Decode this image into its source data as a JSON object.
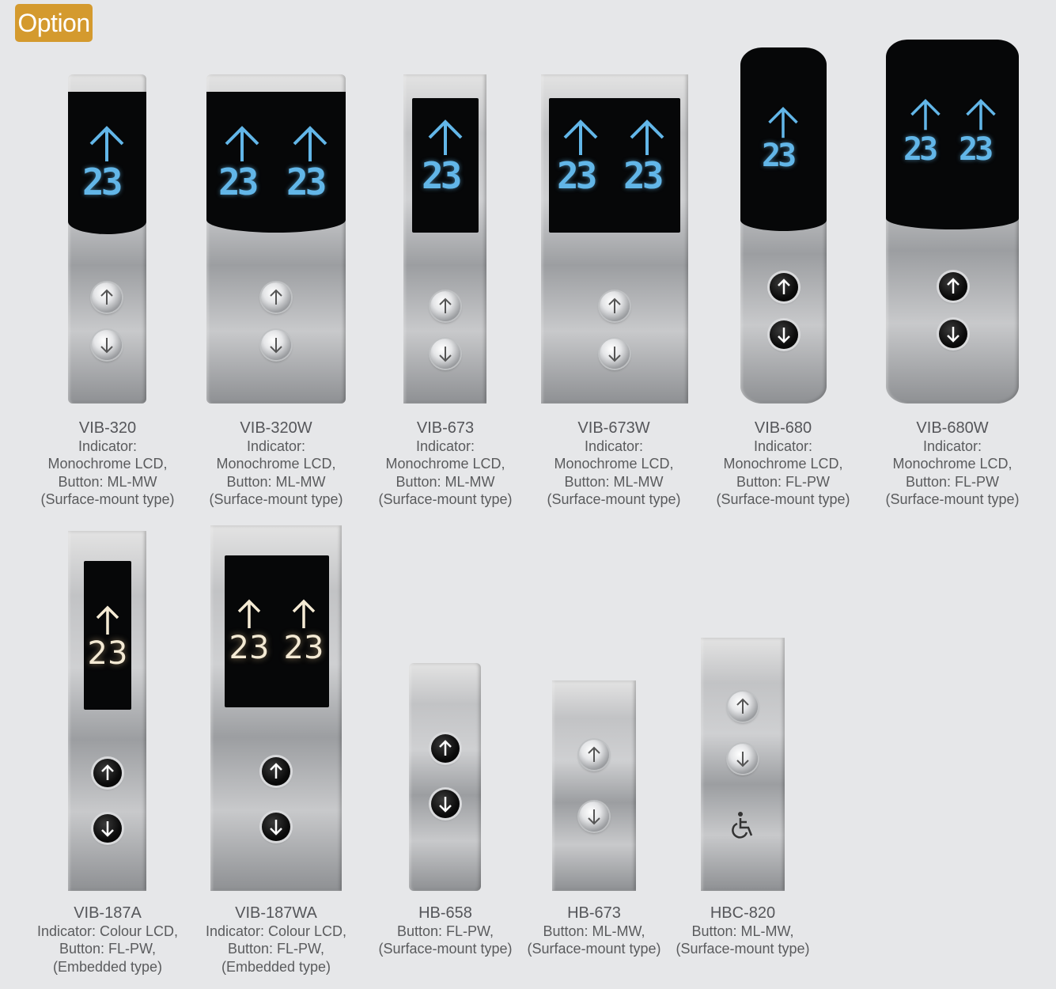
{
  "badge": "Option",
  "row1": [
    {
      "name": "VIB-320",
      "lines": [
        "Indicator:",
        "Monochrome LCD,",
        "Button: ML-MW",
        "(Surface-mount type)"
      ],
      "display": "23"
    },
    {
      "name": "VIB-320W",
      "lines": [
        "Indicator:",
        "Monochrome LCD,",
        "Button: ML-MW",
        "(Surface-mount type)"
      ],
      "display": "23"
    },
    {
      "name": "VIB-673",
      "lines": [
        "Indicator:",
        "Monochrome LCD,",
        "Button: ML-MW",
        "(Surface-mount type)"
      ],
      "display": "23"
    },
    {
      "name": "VIB-673W",
      "lines": [
        "Indicator:",
        "Monochrome LCD,",
        "Button: ML-MW",
        "(Surface-mount type)"
      ],
      "display": "23"
    },
    {
      "name": "VIB-680",
      "lines": [
        "Indicator:",
        "Monochrome LCD,",
        "Button: FL-PW",
        "(Surface-mount type)"
      ],
      "display": "23"
    },
    {
      "name": "VIB-680W",
      "lines": [
        "Indicator:",
        "Monochrome LCD,",
        "Button: FL-PW",
        "(Surface-mount type)"
      ],
      "display": "23"
    }
  ],
  "row2": [
    {
      "name": "VIB-187A",
      "lines": [
        "Indicator: Colour LCD,",
        "Button: FL-PW,",
        "(Embedded type)"
      ],
      "display": "23"
    },
    {
      "name": "VIB-187WA",
      "lines": [
        "Indicator: Colour LCD,",
        "Button: FL-PW,",
        "(Embedded type)"
      ],
      "display": "23"
    },
    {
      "name": "HB-658",
      "lines": [
        "Button: FL-PW,",
        "(Surface-mount type)"
      ]
    },
    {
      "name": "HB-673",
      "lines": [
        "Button: ML-MW,",
        "(Surface-mount type)"
      ]
    },
    {
      "name": "HBC-820",
      "lines": [
        "Button: ML-MW,",
        "(Surface-mount type)"
      ]
    }
  ],
  "icons": [
    "up-arrow-icon",
    "down-arrow-icon",
    "wheelchair-icon"
  ],
  "colors": {
    "badge": "#d49a2e",
    "lcd_mono": "#5fb4e6",
    "lcd_colour": "#f4ead4",
    "background": "#e6e7e9"
  }
}
